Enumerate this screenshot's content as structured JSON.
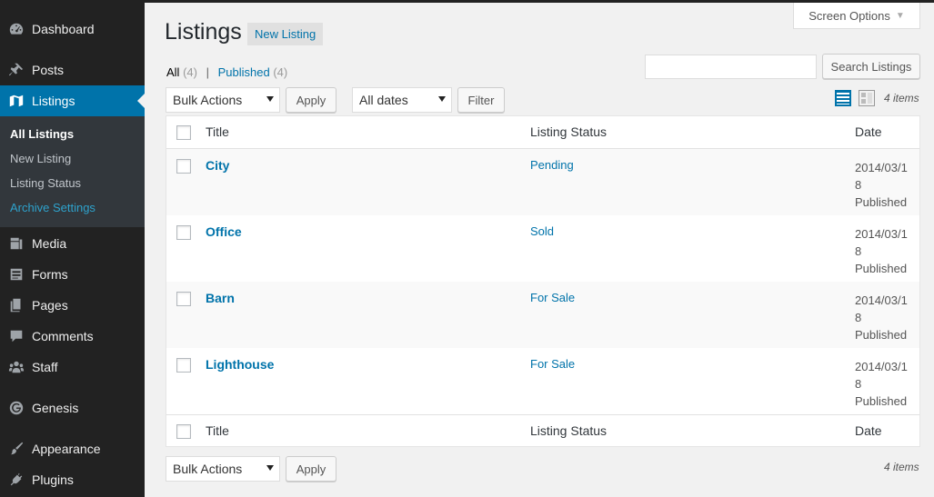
{
  "sidebar": {
    "items": [
      {
        "label": "Dashboard",
        "icon": "dashboard-icon"
      },
      {
        "label": "Posts",
        "icon": "pin-icon"
      },
      {
        "label": "Listings",
        "icon": "map-icon"
      },
      {
        "label": "Media",
        "icon": "media-icon"
      },
      {
        "label": "Forms",
        "icon": "forms-icon"
      },
      {
        "label": "Pages",
        "icon": "pages-icon"
      },
      {
        "label": "Comments",
        "icon": "comment-icon"
      },
      {
        "label": "Staff",
        "icon": "staff-icon"
      },
      {
        "label": "Genesis",
        "icon": "genesis-icon"
      },
      {
        "label": "Appearance",
        "icon": "brush-icon"
      },
      {
        "label": "Plugins",
        "icon": "plug-icon"
      }
    ],
    "submenu": [
      {
        "label": "All Listings"
      },
      {
        "label": "New Listing"
      },
      {
        "label": "Listing Status"
      },
      {
        "label": "Archive Settings"
      }
    ]
  },
  "header": {
    "screen_options": "Screen Options",
    "title": "Listings",
    "new_button": "New Listing"
  },
  "filters": {
    "all_label": "All",
    "all_count": "(4)",
    "separator": "|",
    "published_label": "Published",
    "published_count": "(4)",
    "search_placeholder": "",
    "search_button": "Search Listings",
    "bulk_actions": "Bulk Actions",
    "apply": "Apply",
    "dates": "All dates",
    "filter": "Filter",
    "items_count": "4 items"
  },
  "table": {
    "columns": [
      "Title",
      "Listing Status",
      "Date"
    ],
    "rows": [
      {
        "title": "City",
        "status": "Pending",
        "date": "2014/03/18",
        "state": "Published"
      },
      {
        "title": "Office",
        "status": "Sold",
        "date": "2014/03/18",
        "state": "Published"
      },
      {
        "title": "Barn",
        "status": "For Sale",
        "date": "2014/03/18",
        "state": "Published"
      },
      {
        "title": "Lighthouse",
        "status": "For Sale",
        "date": "2014/03/18",
        "state": "Published"
      }
    ]
  },
  "colors": {
    "accent": "#0073aa",
    "sidebar": "#222222",
    "submenu": "#32373c"
  }
}
